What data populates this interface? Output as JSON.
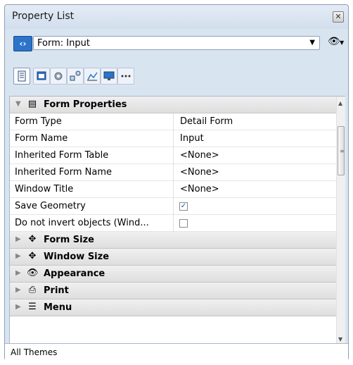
{
  "window": {
    "title": "Property List",
    "close_icon": "close-icon"
  },
  "form_selector": {
    "nav_icon": "nav-arrows-icon",
    "value": "Form: Input",
    "dropdown_icon": "chevron-down-icon",
    "eye_icon": "eye-icon"
  },
  "toolbar": {
    "buttons": [
      {
        "name": "properties-list-icon",
        "active": true
      },
      {
        "name": "form-icon"
      },
      {
        "name": "gear-icon"
      },
      {
        "name": "objects-icon"
      },
      {
        "name": "chart-icon"
      },
      {
        "name": "monitor-icon"
      },
      {
        "name": "more-icon"
      }
    ]
  },
  "grid": {
    "sections": [
      {
        "title": "Form Properties",
        "expanded": true,
        "icon": "form-properties-icon",
        "rows": [
          {
            "name": "Form Type",
            "value": "Detail Form"
          },
          {
            "name": "Form Name",
            "value": "Input"
          },
          {
            "name": "Inherited Form Table",
            "value": "<None>"
          },
          {
            "name": "Inherited Form Name",
            "value": "<None>"
          },
          {
            "name": "Window Title",
            "value": "<None>"
          },
          {
            "name": "Save Geometry",
            "checkbox": true,
            "checked": true
          },
          {
            "name": "Do not invert objects (Wind...",
            "checkbox": true,
            "checked": false
          }
        ]
      },
      {
        "title": "Form Size",
        "expanded": false,
        "icon": "form-size-icon"
      },
      {
        "title": "Window Size",
        "expanded": false,
        "icon": "window-size-icon"
      },
      {
        "title": "Appearance",
        "expanded": false,
        "icon": "appearance-icon"
      },
      {
        "title": "Print",
        "expanded": false,
        "icon": "print-icon"
      },
      {
        "title": "Menu",
        "expanded": false,
        "icon": "menu-icon"
      }
    ]
  },
  "status": {
    "text": "All Themes"
  }
}
